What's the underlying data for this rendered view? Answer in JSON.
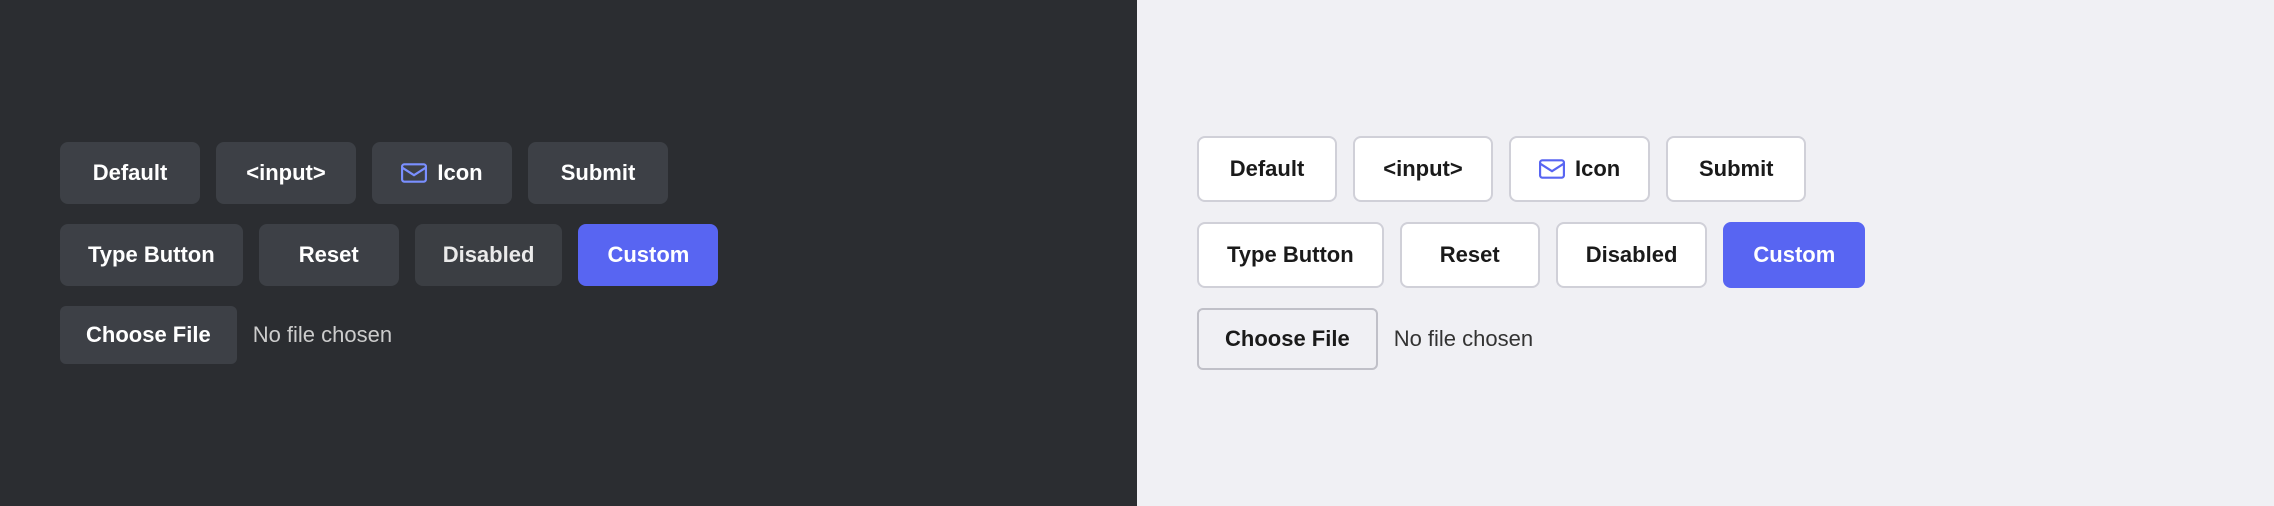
{
  "dark": {
    "row1": {
      "btn1": "Default",
      "btn2": "<input>",
      "btn3": "Icon",
      "btn4": "Submit"
    },
    "row2": {
      "btn1": "Type Button",
      "btn2": "Reset",
      "btn3": "Disabled",
      "btn4": "Custom"
    },
    "file": {
      "choose_label": "Choose File",
      "no_file": "No file chosen"
    }
  },
  "light": {
    "row1": {
      "btn1": "Default",
      "btn2": "<input>",
      "btn3": "Icon",
      "btn4": "Submit"
    },
    "row2": {
      "btn1": "Type Button",
      "btn2": "Reset",
      "btn3": "Disabled",
      "btn4": "Custom"
    },
    "file": {
      "choose_label": "Choose File",
      "no_file": "No file chosen"
    }
  },
  "colors": {
    "custom_bg": "#5865f2",
    "dark_panel": "#2b2d31",
    "light_panel": "#f0f0f4"
  }
}
